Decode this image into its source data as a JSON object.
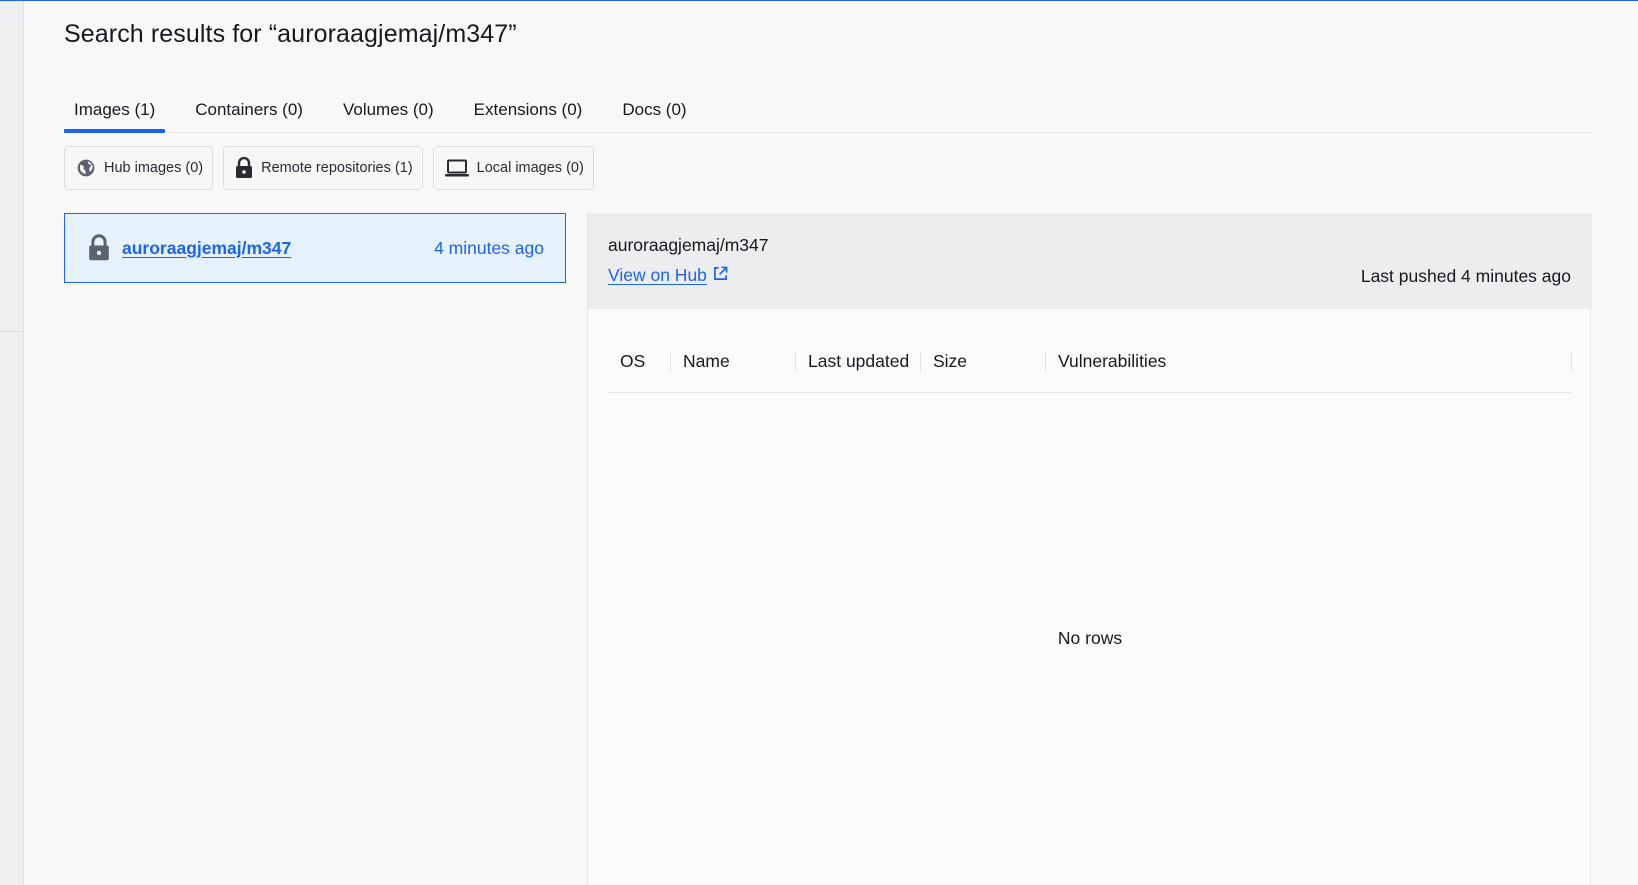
{
  "page": {
    "title": "Search results for “auroraagjemaj/m347”"
  },
  "tabs": [
    {
      "label": "Images (1)",
      "active": true
    },
    {
      "label": "Containers (0)",
      "active": false
    },
    {
      "label": "Volumes (0)",
      "active": false
    },
    {
      "label": "Extensions (0)",
      "active": false
    },
    {
      "label": "Docs (0)",
      "active": false
    }
  ],
  "filters": [
    {
      "label": "Hub images (0)",
      "icon": "globe-icon"
    },
    {
      "label": "Remote repositories (1)",
      "icon": "lock-icon"
    },
    {
      "label": "Local images (0)",
      "icon": "laptop-icon"
    }
  ],
  "results": [
    {
      "name": "auroraagjemaj/m347",
      "time": "4 minutes ago",
      "icon": "lock-icon",
      "selected": true
    }
  ],
  "detail": {
    "title": "auroraagjemaj/m347",
    "view_on_hub": "View on Hub",
    "last_pushed": "Last pushed 4 minutes ago",
    "columns": [
      "OS",
      "Name",
      "Last updated",
      "Size",
      "Vulnerabilities"
    ],
    "empty_text": "No rows"
  },
  "colors": {
    "accent": "#1d63ed",
    "selected_bg": "#e5f2fc",
    "icon_gray": "#5b6271"
  }
}
